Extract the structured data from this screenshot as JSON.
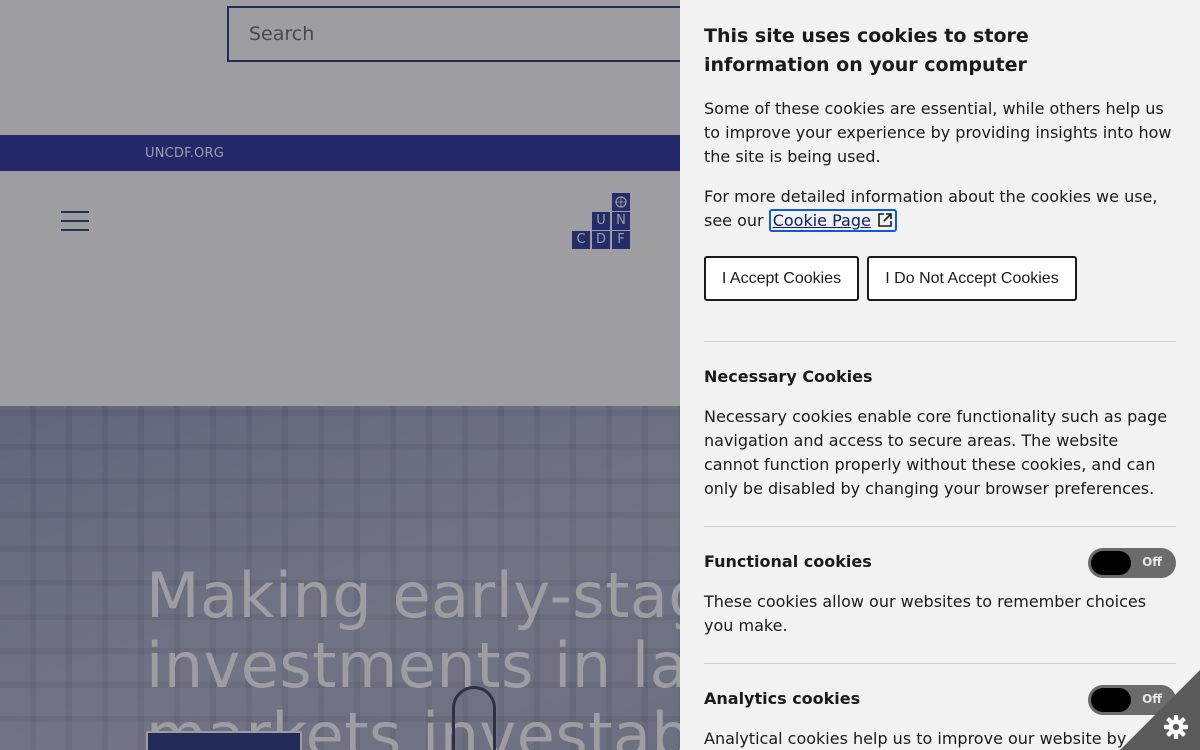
{
  "search": {
    "placeholder": "Search"
  },
  "top_bar": {
    "link": "UNCDF.ORG"
  },
  "logo": {
    "letters": [
      "U",
      "N",
      "C",
      "D",
      "F"
    ]
  },
  "hero": {
    "headline": "Making early-stage investments in last mile markets investable"
  },
  "cookie_panel": {
    "title": "This site uses cookies to store information on your computer",
    "intro": "Some of these cookies are essential, while others help us to improve your experience by providing insights into how the site is being used.",
    "more_info_prefix": "For more detailed information about the cookies we use, see our ",
    "cookie_page_link": "Cookie Page",
    "accept_label": "I Accept Cookies",
    "decline_label": "I Do Not Accept Cookies",
    "categories": [
      {
        "title": "Necessary Cookies",
        "description": "Necessary cookies enable core functionality such as page navigation and access to secure areas. The website cannot function properly without these cookies, and can only be disabled by changing your browser preferences."
      },
      {
        "title": "Functional cookies",
        "description": "These cookies allow our websites to remember choices you make.",
        "toggle": "Off"
      },
      {
        "title": "Analytics cookies",
        "description": "Analytical cookies help us to improve our website by collecting and reporting information on its usage.",
        "toggle": "Off"
      }
    ]
  },
  "colors": {
    "brand_navy": "#0b1c6b",
    "strip_blue": "#0a1490",
    "panel_bg": "#f2f2f2"
  },
  "icons": [
    "hamburger-menu-icon",
    "external-link-icon",
    "gear-icon"
  ]
}
